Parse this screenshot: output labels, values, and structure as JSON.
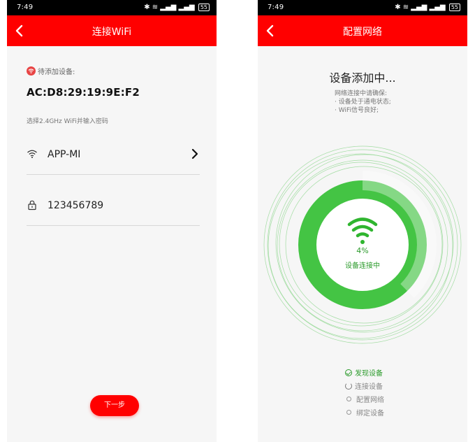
{
  "left": {
    "status": {
      "time": "7:49",
      "battery": "55"
    },
    "nav": {
      "title": "连接WiFi"
    },
    "pending_label": "待添加设备:",
    "mac": "AC:D8:29:19:9E:F2",
    "hint": "选择2.4GHz WiFi并输入密码",
    "wifi_name": "APP-MI",
    "password": "123456789",
    "next_label": "下一步",
    "icons": [
      "back-arrow-icon",
      "wifi-icon",
      "lock-icon",
      "chevron-right-icon"
    ],
    "colors": {
      "accent": "#ff0000"
    }
  },
  "right": {
    "status": {
      "time": "7:49",
      "battery": "55"
    },
    "nav": {
      "title": "配置网络"
    },
    "adding_title": "设备添加中...",
    "notes": [
      "网络连接中请确保:",
      "· 设备处于通电状态;",
      "· WiFi信号良好;"
    ],
    "progress": {
      "percent_text": "4%",
      "value": 0.04,
      "label": "设备连接中"
    },
    "steps": [
      {
        "label": "发现设备",
        "state": "done"
      },
      {
        "label": "连接设备",
        "state": "active"
      },
      {
        "label": "配置网络",
        "state": "todo"
      },
      {
        "label": "绑定设备",
        "state": "todo"
      }
    ],
    "colors": {
      "progress": "#33c133",
      "done": "#2a9a2a"
    }
  }
}
